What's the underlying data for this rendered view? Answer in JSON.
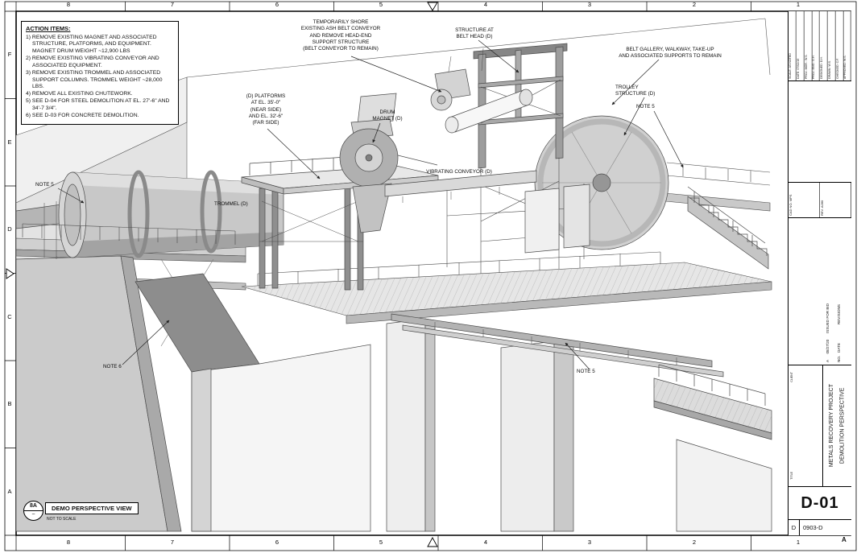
{
  "sheet": {
    "grid_top": [
      "8",
      "7",
      "6",
      "5",
      "4",
      "3",
      "2",
      "1"
    ],
    "grid_bottom": [
      "8",
      "7",
      "6",
      "5",
      "4",
      "3",
      "2",
      "1"
    ],
    "grid_left": [
      "F",
      "E",
      "D",
      "C",
      "B",
      "A"
    ],
    "action_items": {
      "title": "ACTION ITEMS:",
      "items": [
        "1) REMOVE EXISTING MAGNET AND ASSOCIATED STRUCTURE, PLATFORMS, AND EQUIPMENT. MAGNET DRUM WEIGHT ~12,900 LBS",
        "2) REMOVE EXISTING VIBRATING CONVEYOR AND ASSOCIATED EQUIPMENT.",
        "3) REMOVE EXISTING TROMMEL AND ASSOCIATED SUPPORT COLUMNS. TROMMEL WEIGHT ~28,000 LBS.",
        "4) REMOVE ALL EXISTING CHUTEWORK.",
        "5) SEE D-04 FOR STEEL DEMOLITION AT EL. 27'-6\" AND 34'-7 3/4\".",
        "6) SEE D-03 FOR CONCRETE DEMOLITION."
      ]
    },
    "annotations": {
      "temporary_shore": "TEMPORARILY SHORE\nEXISTING ASH BELT CONVEYOR\nAND REMOVE HEAD-END\nSUPPORT STRUCTURE\n(BELT CONVEYOR TO REMAIN)",
      "structure_at_belt_head": "STRUCTURE AT\nBELT HEAD (D)",
      "belt_gallery": "BELT GALLERY, WALKWAY, TAKE-UP\nAND ASSOCIATED SUPPORTS TO REMAIN",
      "trolley_structure": "TROLLEY\nSTRUCTURE (D)",
      "note5_trolley": "NOTE 5",
      "platforms": "(D) PLATFORMS\nAT EL. 35'-0\"\n(NEAR SIDE)\nAND EL. 32'-6\"\n(FAR SIDE)",
      "drum_magnet": "DRUM\nMAGNET (D)",
      "vibrating_conveyor": "VIBRATING CONVEYOR (D)",
      "trommel": "TROMMEL (D)",
      "note5_left": "NOTE 5",
      "note6": "NOTE 6",
      "note5_lower": "NOTE 5"
    },
    "view_callout": {
      "number": "8A",
      "tilde": "~",
      "title": "DEMO PERSPECTIVE VIEW",
      "scale": "NOT TO SCALE"
    },
    "title_block": {
      "info_fields": [
        "SCALE: AS NOTED",
        "DATE: 07/02/19",
        "PROJ. MGR.: W.S.",
        "PROJ. ENG.: D.H.",
        "DESIGNED: D.H.",
        "DRAWN: W.S.",
        "CHECKED: C.F.",
        "APPROVED: W.S."
      ],
      "cad_cells": [
        "CAD NO. MPS",
        "REV. A280"
      ],
      "revision_entry": "A      08/27/20      ISSUED FOR BID",
      "revision_header": "NO.   DATE                  REVISIONS",
      "client_label": "CLIENT",
      "title_label": "TITLE",
      "title_line1": "METALS RECOVERY PROJECT",
      "title_line2": "DEMOLITION PERSPECTIVE",
      "sheet_number": "D-01",
      "dwg_prefix": "D",
      "dwg_number": "0903-D",
      "revision_letter": "A"
    },
    "colors": {
      "line": "#4a4a4a",
      "concrete": "#cbcbcb",
      "steel_dark": "#8d8d8d"
    }
  }
}
